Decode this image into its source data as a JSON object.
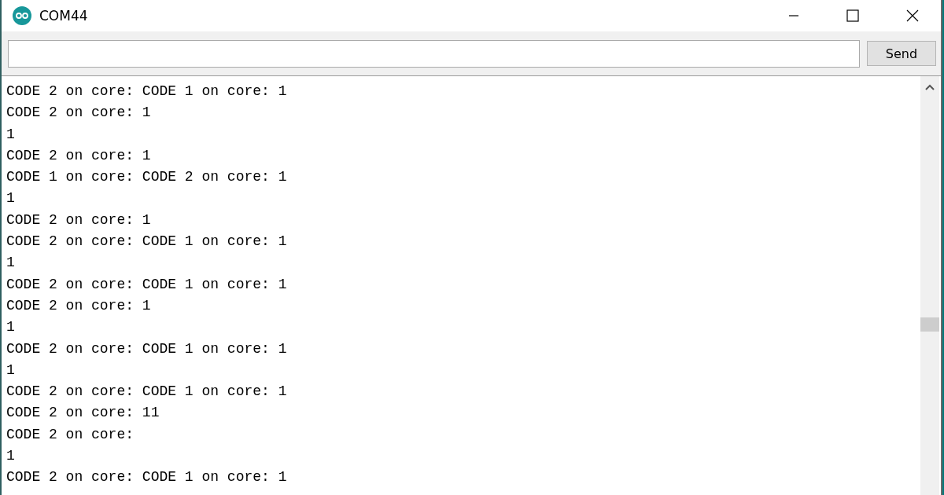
{
  "window": {
    "title": "COM44"
  },
  "send_button": {
    "label": "Send"
  },
  "output_lines": [
    "CODE 2 on core: CODE 1 on core: 1",
    "CODE 2 on core: 1",
    "1",
    "CODE 2 on core: 1",
    "CODE 1 on core: CODE 2 on core: 1",
    "1",
    "CODE 2 on core: 1",
    "CODE 2 on core: CODE 1 on core: 1",
    "1",
    "CODE 2 on core: CODE 1 on core: 1",
    "CODE 2 on core: 1",
    "1",
    "CODE 2 on core: CODE 1 on core: 1",
    "1",
    "CODE 2 on core: CODE 1 on core: 1",
    "CODE 2 on core: 11",
    "CODE 2 on core:",
    "1",
    "CODE 2 on core: CODE 1 on core: 1"
  ]
}
